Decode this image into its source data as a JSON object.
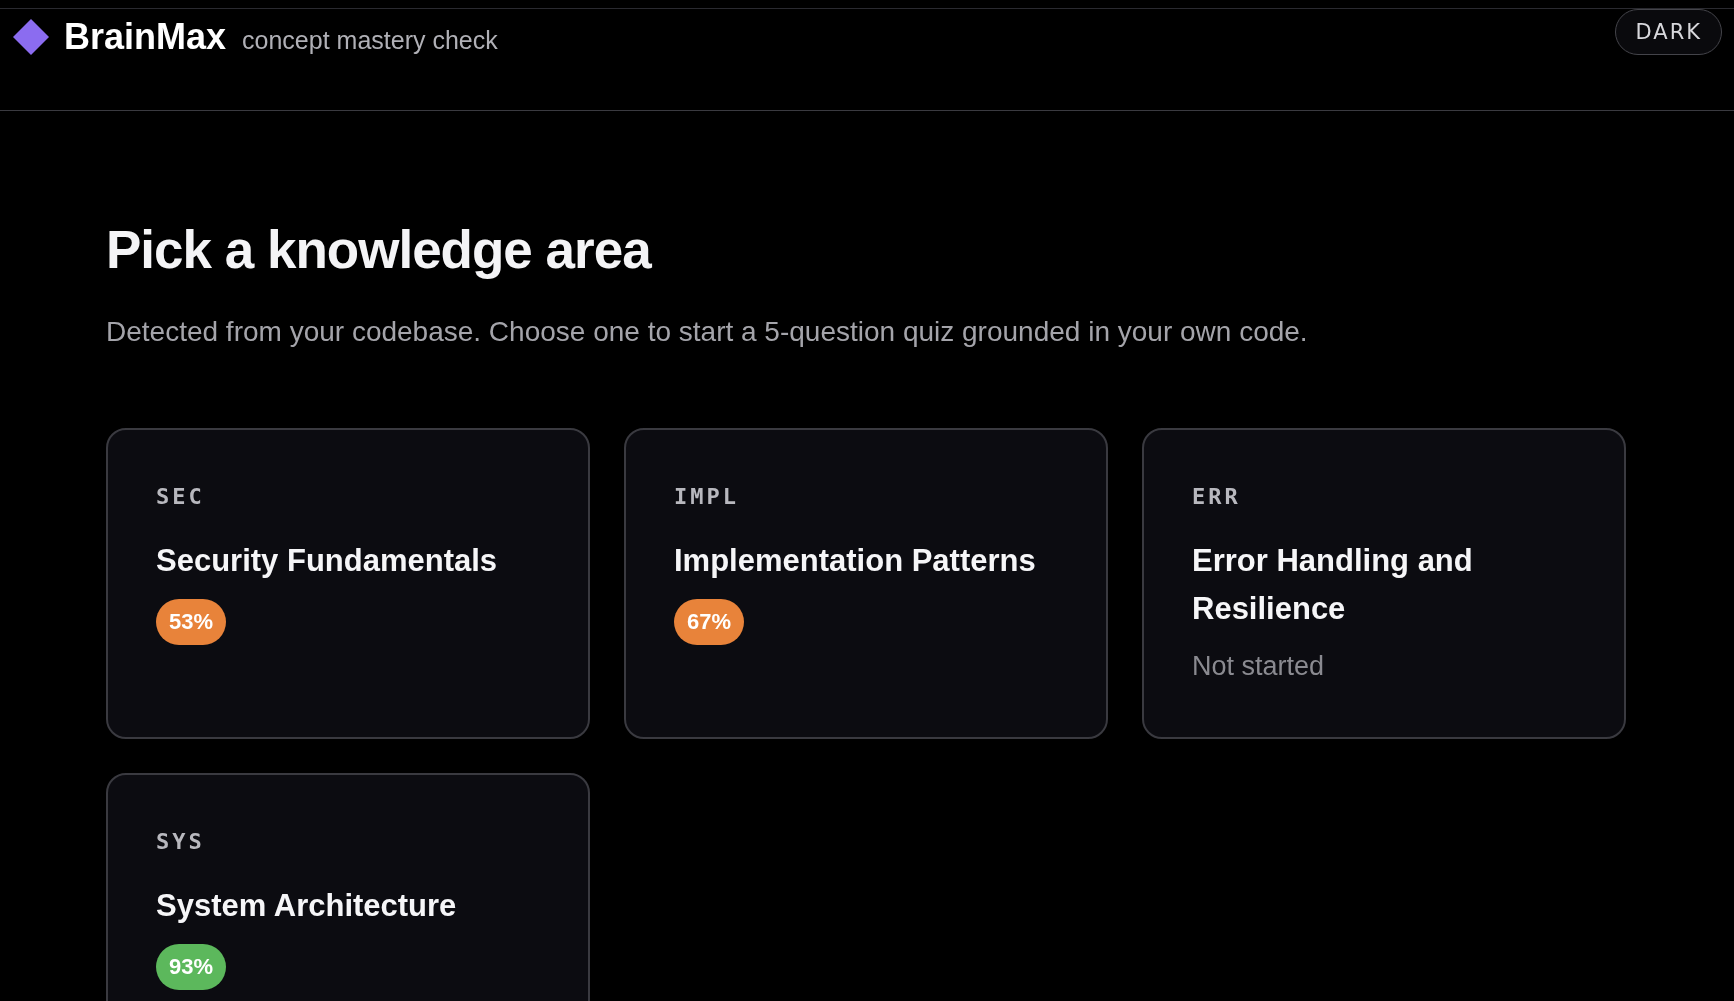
{
  "header": {
    "brand": "BrainMax",
    "tagline": "concept mastery check",
    "theme_button": "DARK"
  },
  "heading": "Pick a knowledge area",
  "intro": "Detected from your codebase. Choose one to start a 5-question quiz grounded in your own code.",
  "areas": [
    {
      "code": "SEC",
      "title": "Security Fundamentals",
      "kind": "score",
      "score": "53%",
      "color": "#e8833a"
    },
    {
      "code": "IMPL",
      "title": "Implementation Patterns",
      "kind": "score",
      "score": "67%",
      "color": "#e8833a"
    },
    {
      "code": "ERR",
      "title": "Error Handling and Resilience",
      "kind": "status",
      "status": "Not started"
    },
    {
      "code": "SYS",
      "title": "System Architecture",
      "kind": "score",
      "score": "93%",
      "color": "#5cb85c"
    }
  ]
}
